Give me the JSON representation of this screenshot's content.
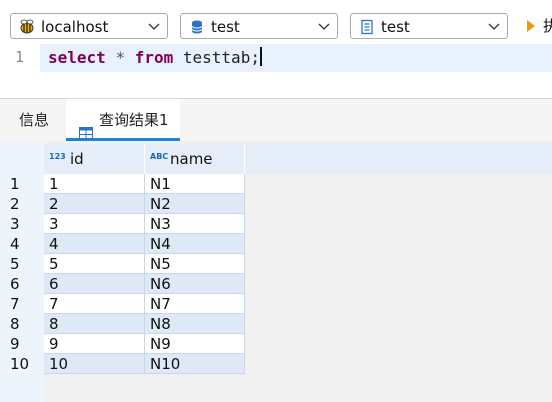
{
  "toolbar": {
    "connection": {
      "label": "localhost",
      "icon": "bee-icon"
    },
    "database": {
      "label": "test",
      "icon": "database-icon"
    },
    "schema": {
      "label": "test",
      "icon": "schema-icon"
    },
    "execute": {
      "label": "执",
      "icon": "play-icon"
    }
  },
  "editor": {
    "line_number": "1",
    "query_keyword_select": "select",
    "query_star": "*",
    "query_keyword_from": "from",
    "query_table": "testtab;"
  },
  "tabs": {
    "info_label": "信息",
    "result_label": "查询结果1"
  },
  "grid": {
    "columns": [
      {
        "type": "123",
        "name": "id"
      },
      {
        "type": "ABC",
        "name": "name"
      }
    ],
    "rows": [
      {
        "num": "1",
        "id": "1",
        "name": "N1"
      },
      {
        "num": "2",
        "id": "2",
        "name": "N2"
      },
      {
        "num": "3",
        "id": "3",
        "name": "N3"
      },
      {
        "num": "4",
        "id": "4",
        "name": "N4"
      },
      {
        "num": "5",
        "id": "5",
        "name": "N5"
      },
      {
        "num": "6",
        "id": "6",
        "name": "N6"
      },
      {
        "num": "7",
        "id": "7",
        "name": "N7"
      },
      {
        "num": "8",
        "id": "8",
        "name": "N8"
      },
      {
        "num": "9",
        "id": "9",
        "name": "N9"
      },
      {
        "num": "10",
        "id": "10",
        "name": "N10"
      }
    ]
  },
  "colors": {
    "accent": "#1a86d6",
    "keyword": "#7f0055",
    "row_alt": "#dde9f7",
    "current_line": "#e8f2fe"
  }
}
